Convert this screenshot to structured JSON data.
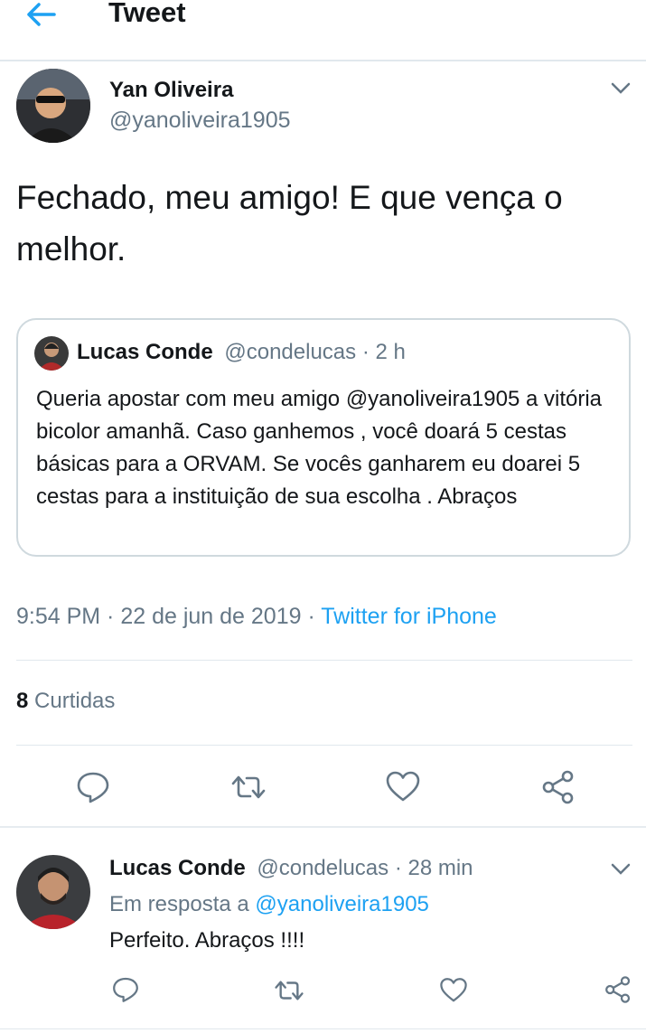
{
  "header": {
    "title": "Tweet",
    "back_icon": "arrow-left-icon"
  },
  "tweet": {
    "author_name": "Yan Oliveira",
    "author_handle": "@yanoliveira1905",
    "text": "Fechado, meu amigo! E que vença o melhor.",
    "timestamp": "9:54 PM · 22 de jun de 2019 · ",
    "source": "Twitter for iPhone",
    "likes_count": "8",
    "likes_label": " Curtidas"
  },
  "quoted_tweet": {
    "author_name": "Lucas Conde",
    "author_handle": "@condelucas",
    "time": " · 2 h",
    "text": "Queria apostar com meu amigo @yanoliveira1905 a vitória bicolor amanhã. Caso ganhemos , você doará 5 cestas básicas para a ORVAM. Se vocês ganharem eu doarei 5 cestas para a instituição de sua escolha . Abraços"
  },
  "actions": [
    "reply-icon",
    "retweet-icon",
    "like-icon",
    "share-icon"
  ],
  "reply": {
    "author_name": "Lucas Conde",
    "author_handle": "@condelucas",
    "time": " · 28 min",
    "in_reply_prefix": "Em resposta a ",
    "in_reply_handle": "@yanoliveira1905",
    "text": "Perfeito. Abraços !!!!"
  },
  "colors": {
    "accent": "#1da1f2",
    "secondary_text": "#657786",
    "divider": "#e1e8ed"
  }
}
